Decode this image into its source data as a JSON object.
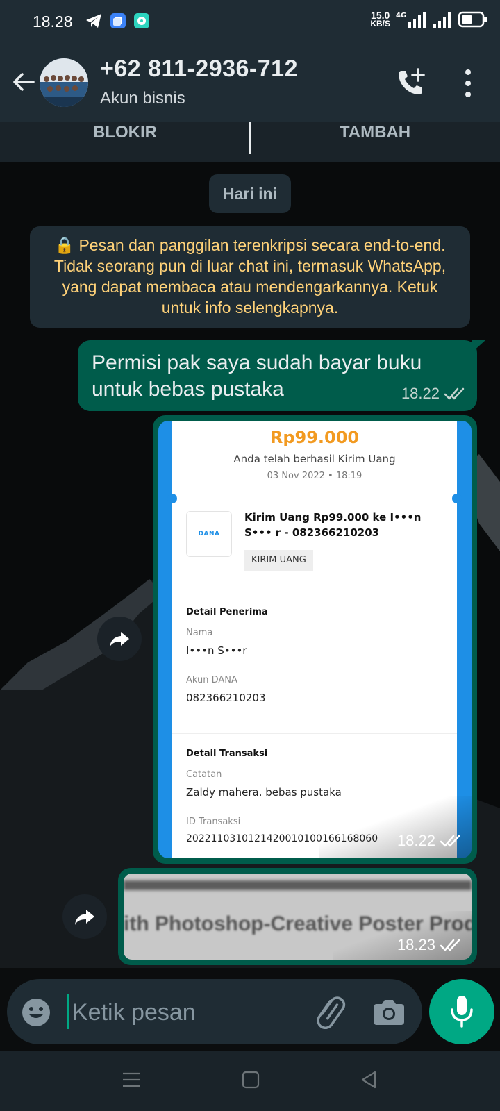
{
  "status_bar": {
    "time": "18.28",
    "net_speed_value": "15.0",
    "net_speed_unit": "KB/S",
    "network_type": "4G"
  },
  "header": {
    "contact_name": "+62 811-2936-712",
    "subtitle": "Akun bisnis"
  },
  "actions": {
    "block_label": "BLOKIR",
    "add_label": "TAMBAH"
  },
  "chat": {
    "date_chip": "Hari ini",
    "encryption_notice": "🔒 Pesan dan panggilan terenkripsi secara end-to-end. Tidak seorang pun di luar chat ini, termasuk WhatsApp, yang dapat membaca atau mendengarkannya. Ketuk untuk info selengkapnya.",
    "messages": [
      {
        "type": "text",
        "text": "Permisi pak saya sudah bayar buku untuk bebas pustaka",
        "time": "18.22",
        "status": "read"
      },
      {
        "type": "image",
        "time": "18.22",
        "status": "read",
        "receipt": {
          "amount": "Rp99.000",
          "status_text": "Anda telah berhasil Kirim Uang",
          "datetime": "03 Nov 2022 • 18:19",
          "logo_text": "DANA",
          "title": "Kirim Uang Rp99.000 ke I•••n S••• r - 082366210203",
          "tag": "KIRIM UANG",
          "recipient_heading": "Detail Penerima",
          "name_label": "Nama",
          "name_value": "I•••n S•••r",
          "account_label": "Akun DANA",
          "account_value": "082366210203",
          "tx_heading": "Detail Transaksi",
          "note_label": "Catatan",
          "note_value": "Zaldy mahera. bebas pustaka",
          "txid_label": "ID Transaksi",
          "txid_value": "2022110310121420010100166168060"
        }
      },
      {
        "type": "image",
        "time": "18.23",
        "status": "read",
        "preview_text": "ith Photoshop-Creative Poster Prod"
      }
    ]
  },
  "composer": {
    "placeholder": "Ketik pesan"
  },
  "colors": {
    "header_bg": "#1f2c34",
    "outgoing_bubble": "#005c4b",
    "accent": "#00a884",
    "notice_text": "#ffd279"
  },
  "icons": [
    "back-arrow-icon",
    "add-call-icon",
    "more-vert-icon",
    "forward-icon",
    "emoji-icon",
    "attach-icon",
    "camera-icon",
    "mic-icon",
    "double-check-icon"
  ]
}
